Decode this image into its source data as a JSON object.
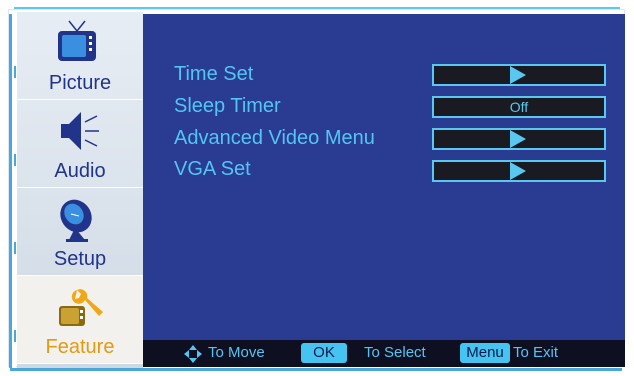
{
  "sidebar": {
    "tabs": [
      {
        "label": "Picture",
        "icon": "tv-icon",
        "active": false
      },
      {
        "label": "Audio",
        "icon": "speaker-icon",
        "active": false
      },
      {
        "label": "Setup",
        "icon": "satellite-dish-icon",
        "active": false
      },
      {
        "label": "Feature",
        "icon": "tools-icon",
        "active": true
      }
    ]
  },
  "menu": {
    "items": [
      {
        "label": "Time Set",
        "value": "",
        "control": "arrow"
      },
      {
        "label": "Sleep Timer",
        "value": "Off",
        "control": "text"
      },
      {
        "label": "Advanced Video Menu",
        "value": "",
        "control": "arrow"
      },
      {
        "label": "VGA Set",
        "value": "",
        "control": "arrow"
      }
    ]
  },
  "footer": {
    "move_label": "To Move",
    "ok_key": "OK",
    "select_label": "To Select",
    "menu_key": "Menu",
    "exit_label": "To Exit"
  },
  "colors": {
    "panel": "#2a3b92",
    "accent": "#53c5f3",
    "active_tab_text": "#e19b12",
    "tab_text": "#22338a"
  }
}
